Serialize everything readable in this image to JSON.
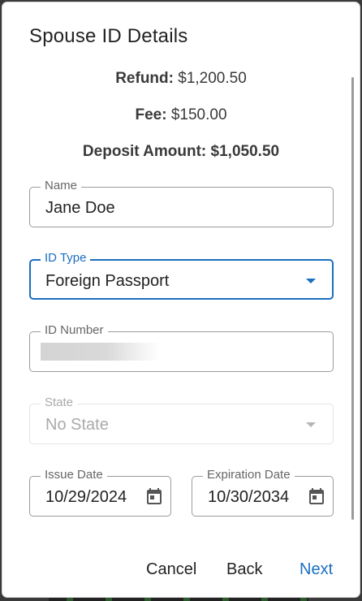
{
  "dialog": {
    "title": "Spouse ID Details"
  },
  "summary": {
    "refund_label": "Refund:",
    "refund_value": "$1,200.50",
    "fee_label": "Fee:",
    "fee_value": "$150.00",
    "deposit_label": "Deposit Amount:",
    "deposit_value": "$1,050.50"
  },
  "form": {
    "name": {
      "label": "Name",
      "value": "Jane Doe"
    },
    "id_type": {
      "label": "ID Type",
      "value": "Foreign Passport",
      "icon": "dropdown-caret"
    },
    "id_number": {
      "label": "ID Number",
      "value": ""
    },
    "state": {
      "label": "State",
      "value": "No State",
      "disabled": true,
      "icon": "dropdown-caret"
    },
    "issue_date": {
      "label": "Issue Date",
      "value": "10/29/2024",
      "icon": "calendar-icon"
    },
    "expiration_date": {
      "label": "Expiration Date",
      "value": "10/30/2034",
      "icon": "calendar-icon"
    }
  },
  "actions": {
    "cancel_label": "Cancel",
    "back_label": "Back",
    "next_label": "Next"
  },
  "colors": {
    "accent": "#1a6fc0",
    "text": "#222222",
    "disabled_text": "#aaaaaa"
  }
}
